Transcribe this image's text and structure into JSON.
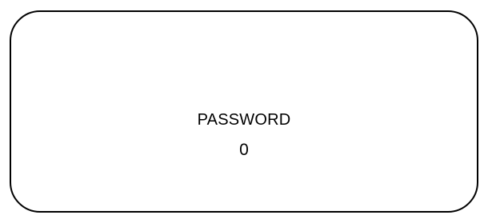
{
  "display": {
    "label": "PASSWORD",
    "value": "0"
  },
  "colors": {
    "border": "#000000",
    "background": "#ffffff",
    "text": "#000000"
  }
}
